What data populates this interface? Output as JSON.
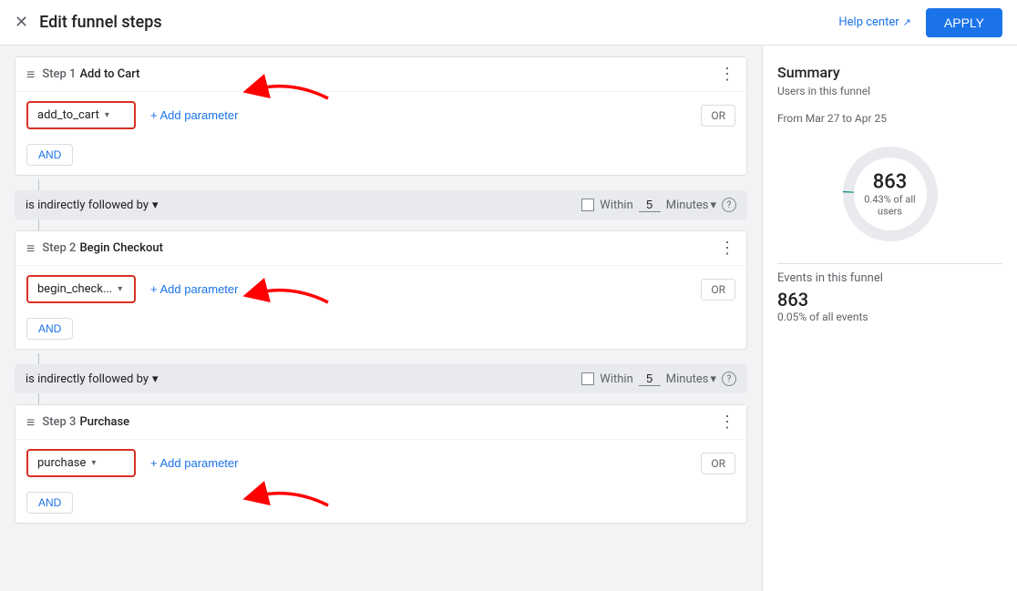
{
  "header": {
    "title": "Edit funnel steps",
    "close_label": "×",
    "help_center_label": "Help center",
    "apply_label": "APPLY"
  },
  "steps": [
    {
      "id": "step1",
      "step_label": "Step 1",
      "step_name": "Add to Cart",
      "event_value": "add_to_cart",
      "add_param_label": "+ Add parameter",
      "or_label": "OR",
      "and_label": "AND"
    },
    {
      "id": "step2",
      "step_label": "Step 2",
      "step_name": "Begin Checkout",
      "event_value": "begin_check...",
      "add_param_label": "+ Add parameter",
      "or_label": "OR",
      "and_label": "AND"
    },
    {
      "id": "step3",
      "step_label": "Step 3",
      "step_name": "Purchase",
      "event_value": "purchase",
      "add_param_label": "+ Add parameter",
      "or_label": "OR",
      "and_label": "AND"
    }
  ],
  "connectors": [
    {
      "id": "conn1",
      "type_label": "is indirectly followed by",
      "within_label": "Within",
      "within_value": "5",
      "unit_label": "Minutes"
    },
    {
      "id": "conn2",
      "type_label": "is indirectly followed by",
      "within_label": "Within",
      "within_value": "5",
      "unit_label": "Minutes"
    }
  ],
  "summary": {
    "title": "Summary",
    "users_label": "Users in this funnel",
    "date_range": "From Mar 27 to Apr 25",
    "users_count": "863",
    "users_percent": "0.43% of all users",
    "events_label": "Events in this funnel",
    "events_count": "863",
    "events_percent": "0.05% of all events",
    "donut_filled": 0.43,
    "donut_color": "#00897b",
    "donut_bg": "#e8eaed"
  },
  "icons": {
    "close": "✕",
    "sort": "☰",
    "more": "⋮",
    "dropdown_arrow": "▾",
    "external_link": "↗",
    "plus": "+",
    "help": "?"
  }
}
